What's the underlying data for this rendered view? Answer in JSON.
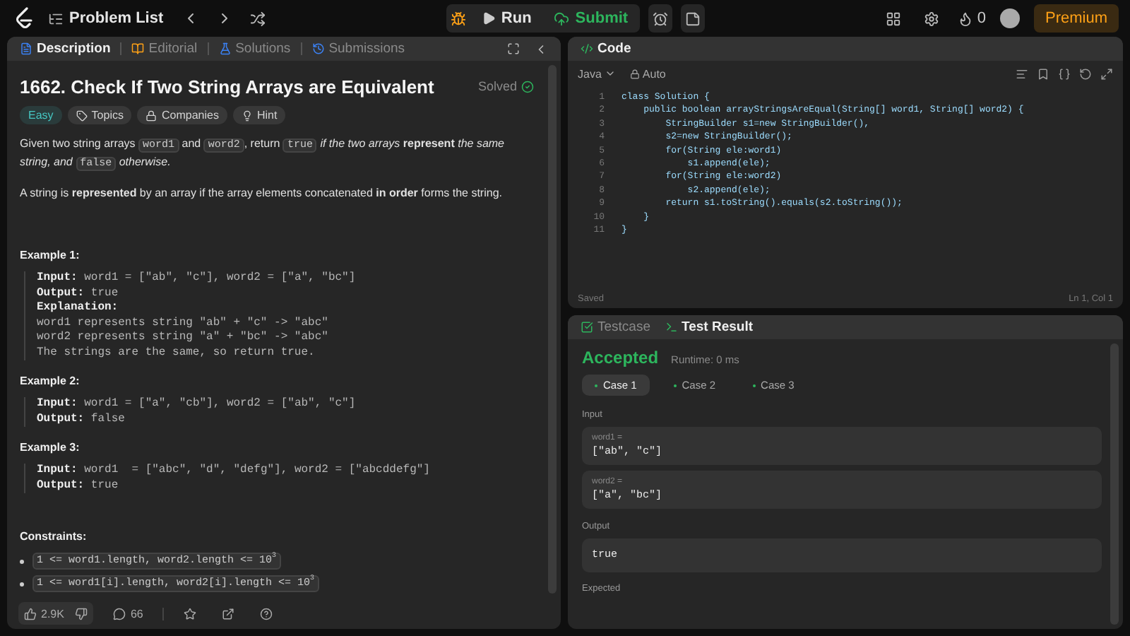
{
  "topbar": {
    "problem_list": "Problem List",
    "run": "Run",
    "submit": "Submit",
    "streak": "0",
    "premium": "Premium"
  },
  "description": {
    "tabs": [
      {
        "label": "Description",
        "selected": true
      },
      {
        "label": "Editorial",
        "selected": false
      },
      {
        "label": "Solutions",
        "selected": false
      },
      {
        "label": "Submissions",
        "selected": false
      }
    ],
    "title": "1662. Check If Two String Arrays are Equivalent",
    "status": "Solved",
    "difficulty": "Easy",
    "tags": [
      "Topics",
      "Companies",
      "Hint"
    ],
    "paragraphs": [
      [
        {
          "kind": "text",
          "text": "Given two string arrays "
        },
        {
          "kind": "code",
          "text": "word1"
        },
        {
          "kind": "text",
          "text": " and "
        },
        {
          "kind": "code",
          "text": "word2"
        },
        {
          "kind": "text",
          "text": ", return "
        },
        {
          "kind": "code",
          "text": "true"
        },
        {
          "kind": "text",
          "text": " *if the two arrays* **represent** *the same string, and* "
        },
        {
          "kind": "code",
          "text": "false"
        },
        {
          "kind": "text",
          "text": " *otherwise.*"
        }
      ],
      [
        {
          "kind": "text",
          "text": "A string is **represented** by an array if the array elements concatenated **in order** forms the string."
        }
      ]
    ],
    "examples": [
      {
        "title": "Example 1:",
        "lines": [
          {
            "label": "Input:",
            "value": "word1 = [\"ab\", \"c\"], word2 = [\"a\", \"bc\"]"
          },
          {
            "label": "Output:",
            "value": "true"
          },
          {
            "label": "Explanation:"
          },
          {
            "value": "word1 represents string \"ab\" + \"c\" -> \"abc\""
          },
          {
            "value": "word2 represents string \"a\" + \"bc\" -> \"abc\""
          },
          {
            "value": "The strings are the same, so return true."
          }
        ]
      },
      {
        "title": "Example 2:",
        "lines": [
          {
            "label": "Input:",
            "value": "word1 = [\"a\", \"cb\"], word2 = [\"ab\", \"c\"]"
          },
          {
            "label": "Output:",
            "value": "false"
          }
        ]
      },
      {
        "title": "Example 3:",
        "lines": [
          {
            "label": "Input:",
            "value": "word1  = [\"abc\", \"d\", \"defg\"], word2 = [\"abcddefg\"]"
          },
          {
            "label": "Output:",
            "value": "true"
          }
        ]
      }
    ],
    "constraints_title": "Constraints:",
    "constraints": [
      "1 <= word1.length, word2.length <= 10$^{3}$",
      "1 <= word1[i].length, word2[i].length <= 10$^{3}$"
    ],
    "likes": "2.9K",
    "comments": "66"
  },
  "editor": {
    "title": "Code",
    "language": "Java",
    "mode": "Auto",
    "lines": [
      "class Solution {",
      "    public boolean arrayStringsAreEqual(String[] word1, String[] word2) {",
      "        StringBuilder s1=new StringBuilder(),",
      "        s2=new StringBuilder();",
      "        for(String ele:word1)",
      "            s1.append(ele);",
      "        for(String ele:word2)",
      "            s2.append(ele);",
      "        return s1.toString().equals(s2.toString());",
      "    }",
      "}"
    ],
    "line_numbers": [
      "1",
      "2",
      "3",
      "4",
      "5",
      "6",
      "7",
      "8",
      "9",
      "10",
      "11"
    ],
    "saved": "Saved",
    "cursor": "Ln 1, Col 1"
  },
  "results": {
    "tabs": [
      {
        "label": "Testcase",
        "selected": false
      },
      {
        "label": "Test Result",
        "selected": true
      }
    ],
    "verdict": "Accepted",
    "runtime": "Runtime: 0 ms",
    "cases": [
      {
        "label": "Case 1",
        "selected": true
      },
      {
        "label": "Case 2",
        "selected": false
      },
      {
        "label": "Case 3",
        "selected": false
      }
    ],
    "input_label": "Input",
    "inputs": [
      {
        "name": "word1 =",
        "value": "[\"ab\", \"c\"]"
      },
      {
        "name": "word2 =",
        "value": "[\"a\", \"bc\"]"
      }
    ],
    "output_label": "Output",
    "output": "true",
    "expected_label": "Expected"
  }
}
